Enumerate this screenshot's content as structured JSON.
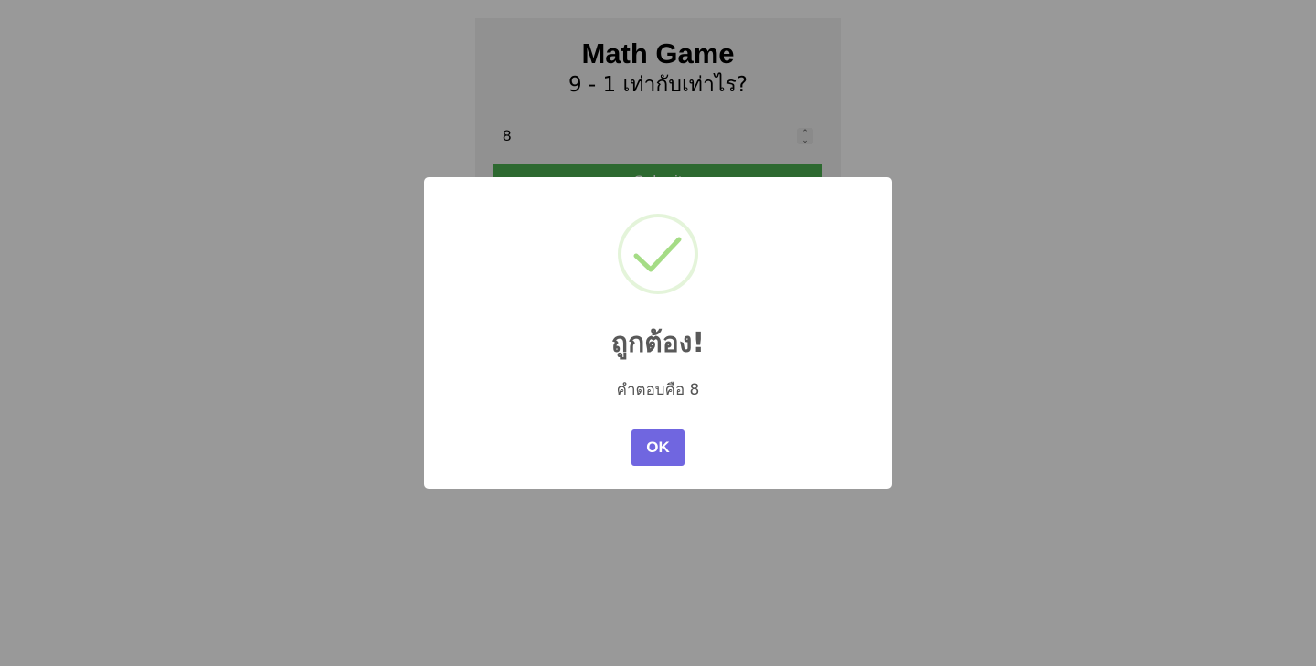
{
  "game": {
    "title": "Math Game",
    "question": "9 - 1 เท่ากับเท่าไร?",
    "answer_value": "8",
    "stepper_up": "⌃",
    "stepper_down": "⌄",
    "submit_label": "Submit"
  },
  "dialog": {
    "icon": "check-icon",
    "title": "ถูกต้อง!",
    "message": "คำตอบคือ 8",
    "ok_label": "OK"
  },
  "colors": {
    "overlay": "rgba(0,0,0,0.4)",
    "submit_button": "#4caf50",
    "ok_button": "#7066e0",
    "success_ring": "#a5dc86"
  }
}
